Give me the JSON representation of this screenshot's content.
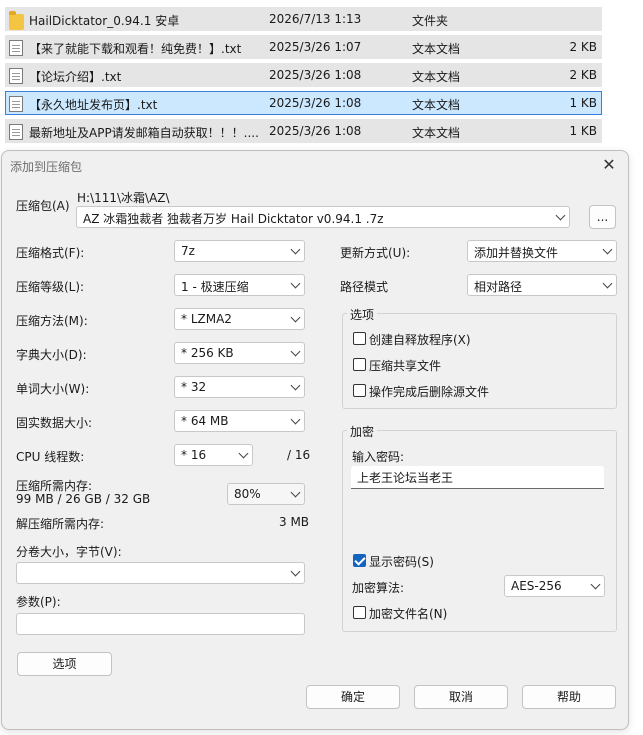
{
  "file_list": [
    {
      "name": "HailDicktator_0.94.1 安卓",
      "date": "2026/7/13 1:13",
      "type": "文件夹",
      "size": "",
      "icon": "folder-icon"
    },
    {
      "name": "【来了就能下载和观看！纯免费！】.txt",
      "date": "2025/3/26 1:07",
      "type": "文本文档",
      "size": "2 KB",
      "icon": "text-file-icon"
    },
    {
      "name": "【论坛介绍】.txt",
      "date": "2025/3/26 1:08",
      "type": "文本文档",
      "size": "2 KB",
      "icon": "text-file-icon"
    },
    {
      "name": "【永久地址发布页】.txt",
      "date": "2025/3/26 1:08",
      "type": "文本文档",
      "size": "1 KB",
      "icon": "text-file-icon"
    },
    {
      "name": "最新地址及APP请发邮箱自动获取！！！....",
      "date": "2025/3/26 1:08",
      "type": "文本文档",
      "size": "1 KB",
      "icon": "text-file-icon"
    }
  ],
  "dialog": {
    "title": "添加到压缩包",
    "close_glyph": "✕",
    "archive": {
      "label": "压缩包(A)",
      "path": "H:\\111\\冰霜\\AZ\\",
      "value": "AZ 冰霜独裁者 独裁者万岁 Hail Dicktator  v0.94.1 .7z",
      "browse_label": "..."
    },
    "format": {
      "label": "压缩格式(F):",
      "value": "7z"
    },
    "level": {
      "label": "压缩等级(L):",
      "value": "1 - 极速压缩"
    },
    "method": {
      "label": "压缩方法(M):",
      "value": "* LZMA2"
    },
    "dict_size": {
      "label": "字典大小(D):",
      "value": "* 256 KB"
    },
    "word_size": {
      "label": "单词大小(W):",
      "value": "* 32"
    },
    "solid_size": {
      "label": "固实数据大小:",
      "value": "* 64 MB"
    },
    "cpu_threads": {
      "label": "CPU 线程数:",
      "value": "* 16",
      "max": "/ 16"
    },
    "mem_compress": {
      "label": "压缩所需内存:",
      "detail": "99 MB / 26 GB / 32 GB",
      "value": "80%"
    },
    "mem_decompress": {
      "label": "解压缩所需内存:",
      "value": "3 MB"
    },
    "volume": {
      "label": "分卷大小，字节(V):",
      "value": ""
    },
    "params": {
      "label": "参数(P):",
      "value": ""
    },
    "options_button": "选项",
    "update_mode": {
      "label": "更新方式(U):",
      "value": "添加并替换文件"
    },
    "path_mode": {
      "label": "路径模式",
      "value": "相对路径"
    },
    "options_group": {
      "title": "选项",
      "items": [
        {
          "label": "创建自释放程序(X)",
          "checked": false
        },
        {
          "label": "压缩共享文件",
          "checked": false
        },
        {
          "label": "操作完成后删除源文件",
          "checked": false
        }
      ]
    },
    "encryption": {
      "title": "加密",
      "password_label": "输入密码:",
      "password_value": "上老王论坛当老王",
      "show_password_label": "显示密码(S)",
      "show_password_checked": true,
      "method_label": "加密算法:",
      "method_value": "AES-256",
      "encrypt_names_label": "加密文件名(N)",
      "encrypt_names_checked": false
    },
    "buttons": {
      "ok": "确定",
      "cancel": "取消",
      "help": "帮助"
    },
    "colors": {
      "accent": "#1565c0",
      "selection": "#cce8ff"
    }
  }
}
